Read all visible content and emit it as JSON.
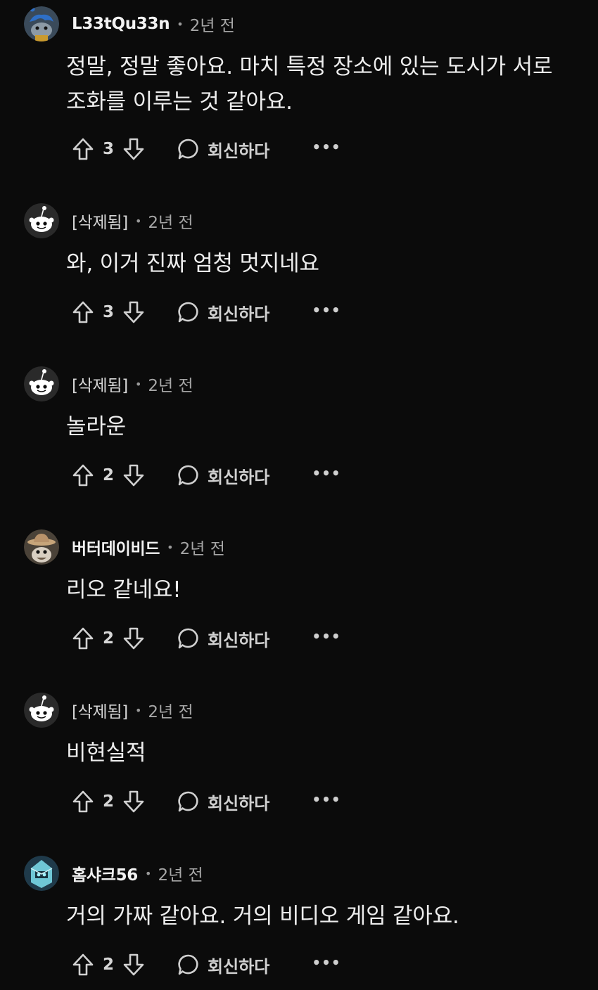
{
  "comments": [
    {
      "author": "L33tQu33n",
      "avatar": "snoo-blue-hair-avatar",
      "time": "2년 전",
      "body_lines": [
        "정말, 정말 좋아요. 마치 특정 장소에 있는 도시가 서로",
        "조화를 이루는 것 같아요."
      ],
      "score": "3",
      "reply_label": "회신하다",
      "more_label": "•••"
    },
    {
      "author": "[삭제됨]",
      "avatar": "default-snoo-avatar",
      "time": "2년 전",
      "body_lines": [
        "와, 이거 진짜 엄청 멋지네요"
      ],
      "score": "3",
      "reply_label": "회신하다",
      "more_label": "•••"
    },
    {
      "author": "[삭제됨]",
      "avatar": "default-snoo-avatar",
      "time": "2년 전",
      "body_lines": [
        "놀라운"
      ],
      "score": "2",
      "reply_label": "회신하다",
      "more_label": "•••"
    },
    {
      "author": "버터데이비드",
      "avatar": "snoo-cowboy-hat-avatar",
      "time": "2년 전",
      "body_lines": [
        "리오 같네요!"
      ],
      "score": "2",
      "reply_label": "회신하다",
      "more_label": "•••"
    },
    {
      "author": "[삭제됨]",
      "avatar": "default-snoo-avatar",
      "time": "2년 전",
      "body_lines": [
        "비현실적"
      ],
      "score": "2",
      "reply_label": "회신하다",
      "more_label": "•••"
    },
    {
      "author": "홈샤크56",
      "avatar": "snoo-robot-helmet-avatar",
      "time": "2년 전",
      "body_lines": [
        "거의 가짜 같아요. 거의 비디오 게임 같아요."
      ],
      "score": "2",
      "reply_label": "회신하다",
      "more_label": "•••"
    }
  ],
  "separator": "•",
  "colors": {
    "background": "#0b0b0b",
    "text": "#ededed",
    "muted": "#a6a6a6"
  }
}
